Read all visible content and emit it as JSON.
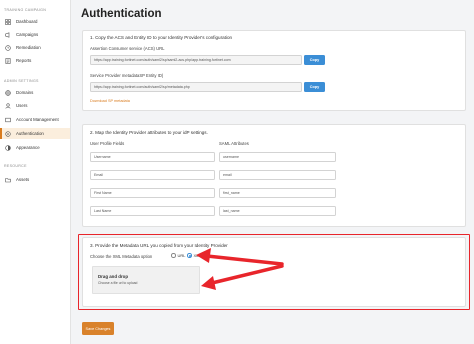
{
  "sidebar": {
    "sections": [
      {
        "label": "TRAINING CAMPAIGN"
      },
      {
        "label": "ADMIN SETTINGS"
      },
      {
        "label": "RESOURCE"
      }
    ],
    "items": [
      {
        "label": "Dashboard",
        "icon": "dashboard-icon"
      },
      {
        "label": "Campaigns",
        "icon": "campaigns-icon"
      },
      {
        "label": "Remediation",
        "icon": "remediation-icon"
      },
      {
        "label": "Reports",
        "icon": "reports-icon"
      },
      {
        "label": "Domains",
        "icon": "domains-icon"
      },
      {
        "label": "Users",
        "icon": "users-icon"
      },
      {
        "label": "Account Management",
        "icon": "account-icon"
      },
      {
        "label": "Authentication",
        "icon": "authentication-icon",
        "active": true
      },
      {
        "label": "Appearance",
        "icon": "appearance-icon"
      },
      {
        "label": "Assets",
        "icon": "assets-icon"
      }
    ]
  },
  "page": {
    "title": "Authentication"
  },
  "step1": {
    "title": "1. Copy the ACS and Entity ID to your Identity Provider's configuration",
    "acs_label": "Assertion Consumer service (ACS) URL",
    "acs_value": "https://app.training.fortinet.com/auth/saml2/sp/saml2-acs.php/app.training.fortinet.com",
    "entity_label": "Service Provider metadataSP Entity ID)",
    "entity_value": "https://app.training.fortinet.com/auth/saml2/sp/metadata.php",
    "copy_label": "Copy",
    "download_label": "Download SP metadata"
  },
  "step2": {
    "title": "2. Map the Identity Provider attributes to your idP settings.",
    "col_user": "User Profile Fields",
    "col_saml": "SAML Attributes",
    "rows": [
      {
        "profile": "Username",
        "saml": "username"
      },
      {
        "profile": "Email",
        "saml": "email"
      },
      {
        "profile": "First Name",
        "saml": "first_name"
      },
      {
        "profile": "Last Name",
        "saml": "last_name"
      }
    ]
  },
  "step3": {
    "title": "3. Provide the Metadata URL you copied from your Identity Provider",
    "option_label": "Choose the XML Metadata option",
    "option_url": "URL",
    "option_xml": "XML File",
    "selected": "XML File",
    "drop_title": "Drag and drop",
    "drop_sub": "Choose a file url to upload"
  },
  "actions": {
    "save_label": "Save Changes"
  },
  "colors": {
    "accent": "#d9822b",
    "primary": "#3b8ed6",
    "annotation": "#e8252b"
  }
}
